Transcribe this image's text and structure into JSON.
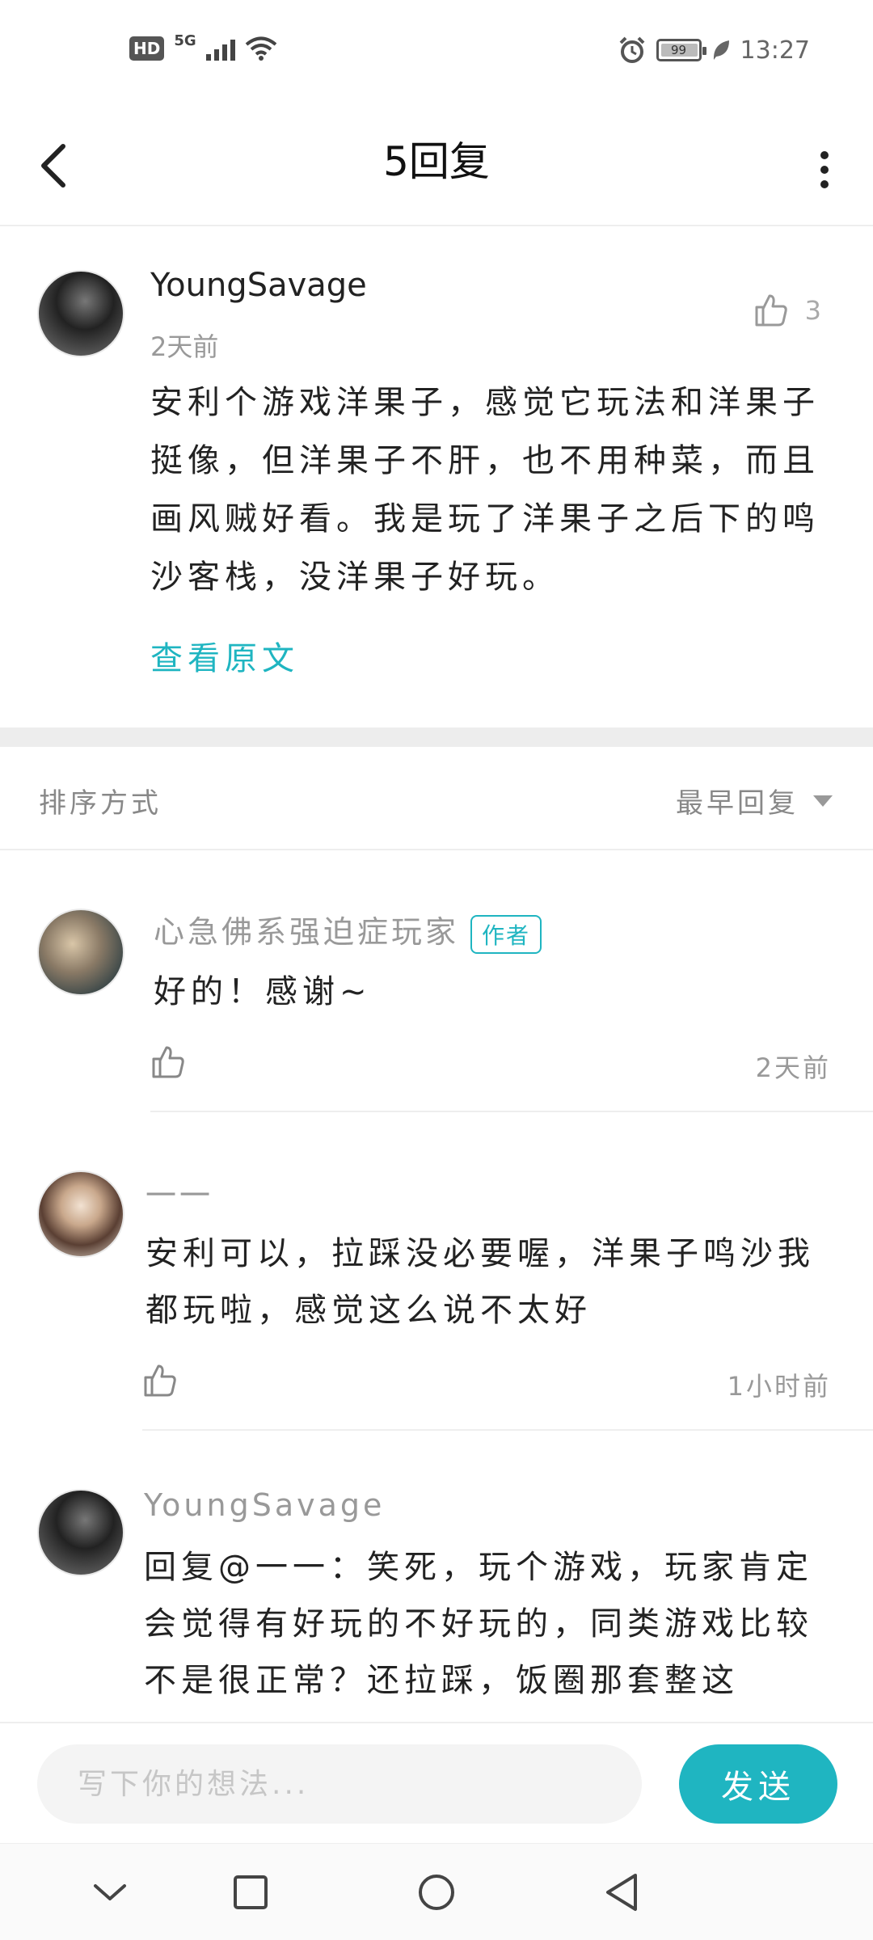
{
  "status_bar": {
    "hd": "HD",
    "network": "5G",
    "battery": "99",
    "time": "13:27"
  },
  "header": {
    "title": "5回复"
  },
  "post": {
    "author": "YoungSavage",
    "time": "2天前",
    "likes": "3",
    "text": "安利个游戏洋果子，感觉它玩法和洋果子挺像，但洋果子不肝，也不用种菜，而且画风贼好看。我是玩了洋果子之后下的鸣沙客栈，没洋果子好玩。",
    "view_original": "查看原文"
  },
  "sort": {
    "label": "排序方式",
    "selected": "最早回复"
  },
  "replies": [
    {
      "name": "心急佛系强迫症玩家",
      "badge": "作者",
      "text": "好的！感谢~",
      "time": "2天前"
    },
    {
      "name": "一一",
      "text": "安利可以，拉踩没必要喔，洋果子鸣沙我都玩啦，感觉这么说不太好",
      "time": "1小时前"
    },
    {
      "name": "YoungSavage",
      "text": "回复@一一：笑死，玩个游戏，玩家肯定会觉得有好玩的不好玩的，同类游戏比较不是很正常？还拉踩，饭圈那套整这"
    }
  ],
  "comment": {
    "placeholder": "写下你的想法...",
    "send": "发送"
  },
  "colors": {
    "accent": "#1fb5c1",
    "muted_text": "#999999",
    "divider": "#eeeeee"
  },
  "icons": {
    "back": "chevron-left-icon",
    "more": "more-vertical-icon",
    "like": "thumbs-up-icon",
    "dropdown": "triangle-down-icon",
    "nav_collapse": "chevron-down-icon",
    "nav_recents": "square-icon",
    "nav_home": "circle-icon",
    "nav_back": "triangle-back-icon"
  }
}
